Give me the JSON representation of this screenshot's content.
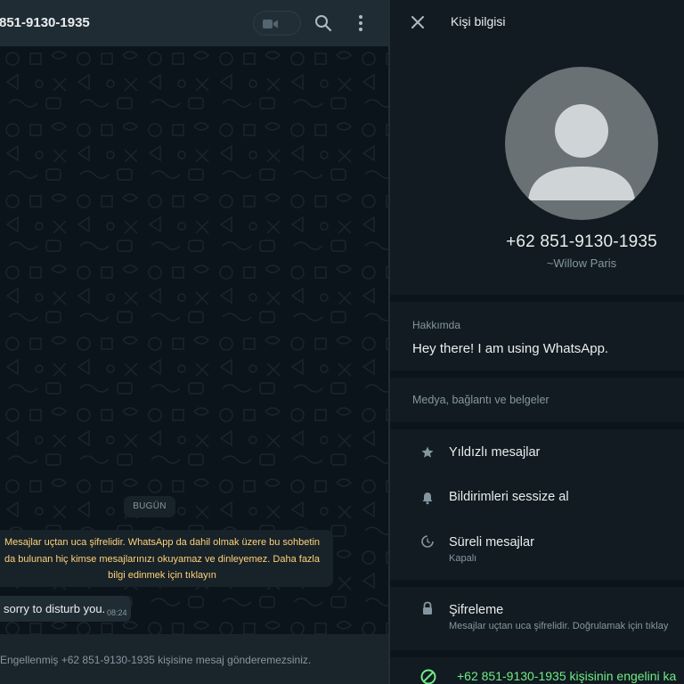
{
  "chat": {
    "title": "851-9130-1935",
    "date_chip": "BUGÜN",
    "encryption_notice": "Mesajlar uçtan uca şifrelidir. WhatsApp da dahil olmak üzere bu sohbetin da bulunan hiç kimse mesajlarınızı okuyamaz ve dinleyemez. Daha fazla bilgi edinmek için tıklayın",
    "message": {
      "text": "sorry to disturb you.",
      "time": "08:24"
    },
    "footer_text": "Engellenmiş +62 851-9130-1935 kişisine mesaj gönderemezsiniz.",
    "icons": {
      "video": "video-camera-icon",
      "dropdown": "chevron-down-icon",
      "search": "search-icon",
      "menu": "more-vertical-icon"
    }
  },
  "contact_info": {
    "title": "Kişi bilgisi",
    "phone": "+62 851-9130-1935",
    "name": "~Willow Paris",
    "about_label": "Hakkımda",
    "about_text": "Hey there! I am using WhatsApp.",
    "media_label": "Medya, bağlantı ve belgeler",
    "options": [
      {
        "label": "Yıldızlı mesajlar",
        "icon": "star-icon"
      },
      {
        "label": "Bildirimleri sessize al",
        "icon": "bell-icon"
      },
      {
        "label": "Süreli mesajlar",
        "sub": "Kapalı",
        "icon": "timer-icon"
      }
    ],
    "encryption": {
      "label": "Şifreleme",
      "sub": "Mesajlar uçtan uca şifrelidir. Doğrulamak için tıklay",
      "icon": "lock-icon"
    },
    "unblock": {
      "label": "+62 851-9130-1935 kişisinin engelini ka",
      "icon": "unblock-icon"
    }
  },
  "colors": {
    "panel": "#111b21",
    "background": "#0b141a",
    "header": "#202c33",
    "primary_text": "#e9edef",
    "secondary_text": "#8696a0",
    "notice_text": "#ffd279",
    "accent_green": "#71eb85"
  }
}
